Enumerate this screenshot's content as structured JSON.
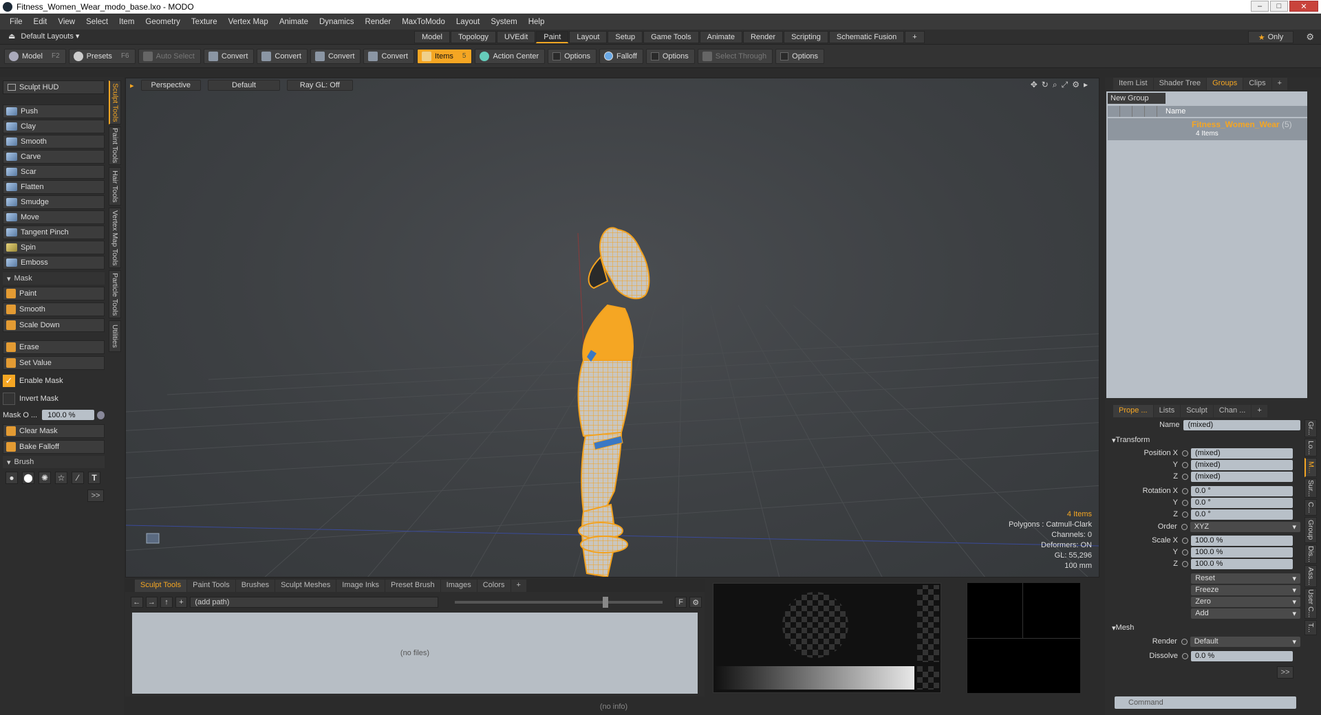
{
  "window": {
    "title": "Fitness_Women_Wear_modo_base.lxo - MODO",
    "controls": [
      "–",
      "□",
      "✕"
    ]
  },
  "menu": [
    "File",
    "Edit",
    "View",
    "Select",
    "Item",
    "Geometry",
    "Texture",
    "Vertex Map",
    "Animate",
    "Dynamics",
    "Render",
    "MaxToModo",
    "Layout",
    "System",
    "Help"
  ],
  "layout": {
    "selector": "Default Layouts ▾",
    "tabs": [
      "Model",
      "Topology",
      "UVEdit",
      "Paint",
      "Layout",
      "Setup",
      "Game Tools",
      "Animate",
      "Render",
      "Scripting",
      "Schematic Fusion",
      "+"
    ],
    "active_tab": "Paint",
    "only_label": "Only"
  },
  "toolbar": {
    "model": "Model",
    "model_key": "F2",
    "presets": "Presets",
    "presets_key": "F6",
    "auto_select": "Auto Select",
    "convert1": "Convert",
    "convert2": "Convert",
    "convert3": "Convert",
    "convert4": "Convert",
    "items": "Items",
    "items_key": "5",
    "action_center": "Action Center",
    "options1": "Options",
    "falloff": "Falloff",
    "options2": "Options",
    "select_through": "Select Through",
    "options3": "Options"
  },
  "left": {
    "hud": "Sculpt HUD",
    "tools": [
      "Push",
      "Clay",
      "Smooth",
      "Carve",
      "Scar",
      "Flatten",
      "Smudge",
      "Move",
      "Tangent Pinch",
      "Spin",
      "Emboss"
    ],
    "mask_header": "Mask",
    "mask_tools": [
      "Paint",
      "Smooth",
      "Scale Down"
    ],
    "mask_tools2": [
      "Erase",
      "Set Value"
    ],
    "enable_mask": "Enable Mask",
    "invert_mask": "Invert Mask",
    "mask_opacity_label": "Mask O ...",
    "mask_opacity_value": "100.0 %",
    "mask_tools3": [
      "Clear Mask",
      "Bake Falloff"
    ],
    "brush_header": "Brush",
    "brush_text_icon": "T",
    "expand": ">>",
    "vtabs": [
      "Sculpt Tools",
      "Paint Tools",
      "Hair Tools",
      "Vertex Map Tools",
      "Particle Tools",
      "Utilities"
    ]
  },
  "viewport": {
    "view": "Perspective",
    "shading": "Default",
    "raygl": "Ray GL: Off",
    "info": {
      "items": "4 Items",
      "polygons": "Polygons : Catmull-Clark",
      "channels": "Channels: 0",
      "deformers": "Deformers: ON",
      "gl": "GL: 55,296",
      "scale": "100 mm"
    }
  },
  "browser": {
    "tabs": [
      "Sculpt Tools",
      "Paint Tools",
      "Brushes",
      "Sculpt Meshes",
      "Image Inks",
      "Preset Brush",
      "Images",
      "Colors",
      "+"
    ],
    "active": "Sculpt Tools",
    "path": "(add path)",
    "empty": "(no files)",
    "f_label": "F"
  },
  "status": "(no info)",
  "groups": {
    "tabs": [
      "Item List",
      "Shader Tree",
      "Groups",
      "Clips",
      "+"
    ],
    "active": "Groups",
    "new_group": "New Group",
    "col_name": "Name",
    "group_name": "Fitness_Women_Wear",
    "group_suffix": "(5)",
    "group_count": "4 Items"
  },
  "properties": {
    "tabs": [
      "Prope ...",
      "Lists",
      "Sculpt",
      "Chan ...",
      "+"
    ],
    "active": "Prope ...",
    "name_label": "Name",
    "name_value": "(mixed)",
    "transform": "Transform",
    "pos_x_label": "Position X",
    "pos_x": "(mixed)",
    "pos_y": "(mixed)",
    "pos_z": "(mixed)",
    "rot_x_label": "Rotation X",
    "rot_x": "0.0 °",
    "rot_y": "0.0 °",
    "rot_z": "0.0 °",
    "order_label": "Order",
    "order": "XYZ",
    "scale_x_label": "Scale X",
    "scale_x": "100.0 %",
    "scale_y": "100.0 %",
    "scale_z": "100.0 %",
    "y_label": "Y",
    "z_label": "Z",
    "reset": "Reset",
    "freeze": "Freeze",
    "zero": "Zero",
    "add": "Add",
    "mesh": "Mesh",
    "render_label": "Render",
    "render": "Default",
    "dissolve_label": "Dissolve",
    "dissolve": "0.0 %",
    "expand": ">>",
    "vtabs": [
      "Gr...",
      "Lo...",
      "M...",
      "Sur...",
      "C...",
      "Group",
      "Dis...",
      "Ass...",
      "User C...",
      "T..."
    ],
    "command": "Command"
  },
  "colors": {
    "accent": "#f5a623",
    "wire": "#f3a21f"
  }
}
